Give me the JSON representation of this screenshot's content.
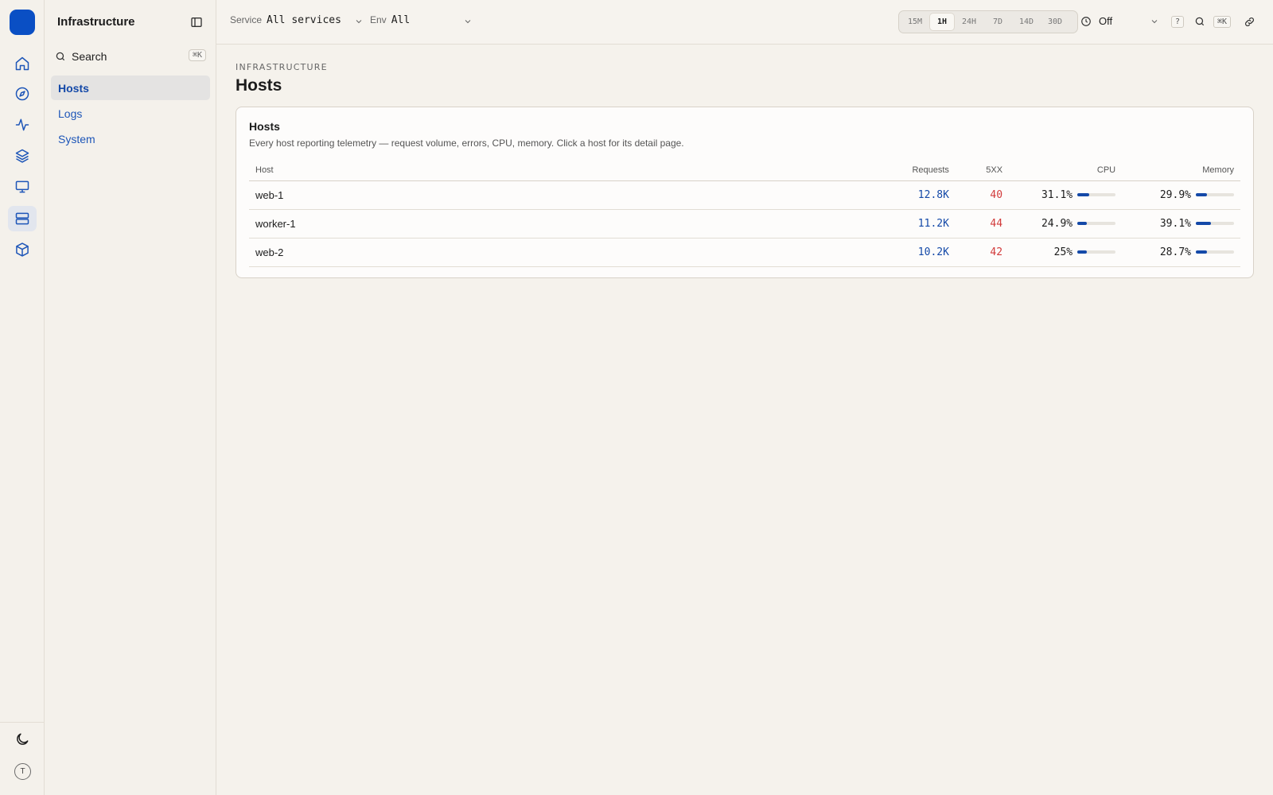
{
  "rail": {
    "items": [
      {
        "icon": "home-icon",
        "active": false
      },
      {
        "icon": "compass-icon",
        "active": false
      },
      {
        "icon": "activity-icon",
        "active": false
      },
      {
        "icon": "layers-icon",
        "active": false
      },
      {
        "icon": "monitor-icon",
        "active": false
      },
      {
        "icon": "server-icon",
        "active": true
      },
      {
        "icon": "package-icon",
        "active": false
      }
    ],
    "theme_icon": "moon-icon",
    "avatar_initial": "T"
  },
  "sidebar": {
    "title": "Infrastructure",
    "search_label": "Search",
    "search_shortcut": "⌘K",
    "items": [
      {
        "label": "Hosts",
        "active": true
      },
      {
        "label": "Logs",
        "active": false
      },
      {
        "label": "System",
        "active": false
      }
    ]
  },
  "topbar": {
    "service_label": "Service",
    "service_value": "All services",
    "env_label": "Env",
    "env_value": "All",
    "ranges": [
      "15M",
      "1H",
      "24H",
      "7D",
      "14D",
      "30D"
    ],
    "active_range": "1H",
    "refresh_value": "Off",
    "help_label": "?",
    "search_shortcut": "⌘K"
  },
  "page": {
    "breadcrumb": "INFRASTRUCTURE",
    "title": "Hosts"
  },
  "hosts_card": {
    "title": "Hosts",
    "description": "Every host reporting telemetry — request volume, errors, CPU, memory. Click a host for its detail page.",
    "columns": {
      "host": "Host",
      "requests": "Requests",
      "errors": "5XX",
      "cpu": "CPU",
      "memory": "Memory"
    },
    "rows": [
      {
        "host": "web-1",
        "requests": "12.8K",
        "errors": "40",
        "cpu": "31.1%",
        "cpu_value": 0.311,
        "memory": "29.9%",
        "memory_value": 0.299
      },
      {
        "host": "worker-1",
        "requests": "11.2K",
        "errors": "44",
        "cpu": "24.9%",
        "cpu_value": 0.249,
        "memory": "39.1%",
        "memory_value": 0.391
      },
      {
        "host": "web-2",
        "requests": "10.2K",
        "errors": "42",
        "cpu": "25%",
        "cpu_value": 0.25,
        "memory": "28.7%",
        "memory_value": 0.287
      }
    ]
  },
  "colors": {
    "accent": "#1449a8",
    "error": "#d23b3b",
    "background": "#f5f2ec"
  }
}
